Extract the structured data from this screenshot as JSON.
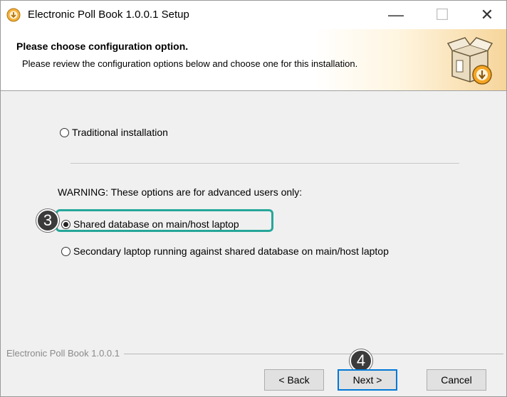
{
  "window": {
    "title": "Electronic Poll Book 1.0.0.1 Setup",
    "minimize_glyph": "—",
    "maximize_glyph": "☐",
    "close_glyph": "✕"
  },
  "header": {
    "title": "Please choose configuration option.",
    "subtitle": "Please review the configuration options below and choose one for this installation.",
    "icon": "installer-box-icon"
  },
  "options": {
    "traditional": {
      "label": "Traditional installation",
      "selected": false
    },
    "warning": "WARNING: These options are for advanced users only:",
    "shared": {
      "label": "Shared database on main/host laptop",
      "selected": true
    },
    "secondary": {
      "label": "Secondary laptop running against shared database on main/host laptop",
      "selected": false
    }
  },
  "annotations": {
    "step3": "3",
    "step4": "4",
    "highlight_color": "#26a69a"
  },
  "footer": {
    "brand": "Electronic Poll Book 1.0.0.1",
    "back_label": "< Back",
    "next_label": "Next >",
    "cancel_label": "Cancel"
  }
}
